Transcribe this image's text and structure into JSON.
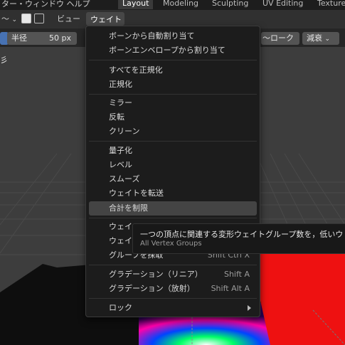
{
  "topbar": {
    "menus": [
      "ター・ウィンドウ ヘルプ"
    ],
    "tabs": [
      "Layout",
      "Modeling",
      "Sculpting",
      "UV Editing",
      "Texture"
    ],
    "active_tab": "Layout"
  },
  "header": {
    "mode_dropdown": "～",
    "view_label": "ビュー",
    "weight_label": "ウェイト"
  },
  "toolrow": {
    "radius_label": "半径",
    "radius_value": "50 px",
    "stroke_label": "～ローク",
    "falloff_label": "減衰",
    "left_text": "彡"
  },
  "menu": {
    "items": [
      {
        "label": "ボーンから自動割り当て"
      },
      {
        "label": "ボーンエンベロープから割り当て"
      },
      {
        "label": "すべてを正規化"
      },
      {
        "label": "正規化"
      },
      {
        "label": "ミラー"
      },
      {
        "label": "反転"
      },
      {
        "label": "クリーン"
      },
      {
        "label": "量子化"
      },
      {
        "label": "レベル"
      },
      {
        "label": "スムーズ"
      },
      {
        "label": "ウェイトを転送"
      },
      {
        "label": "合計を制限"
      },
      {
        "label": "ウェイ"
      },
      {
        "label": "ウェイ"
      },
      {
        "label": "グループを探取",
        "shortcut": "Shift Ctrl X"
      },
      {
        "label": "グラデーション（リニア）",
        "shortcut": "Shift A"
      },
      {
        "label": "グラデーション（放射）",
        "shortcut": "Shift Alt A"
      },
      {
        "label": "ロック"
      }
    ]
  },
  "tooltip": {
    "text": "一つの頂点に関連する変形ウェイトグループ数を，低いウ",
    "subtext": "All Vertex Groups"
  },
  "colors": {
    "accent_blue": "#4772b3",
    "menu_bg": "#1c1c1c",
    "highlight": "#444444",
    "red_mesh": "#ee1111"
  }
}
